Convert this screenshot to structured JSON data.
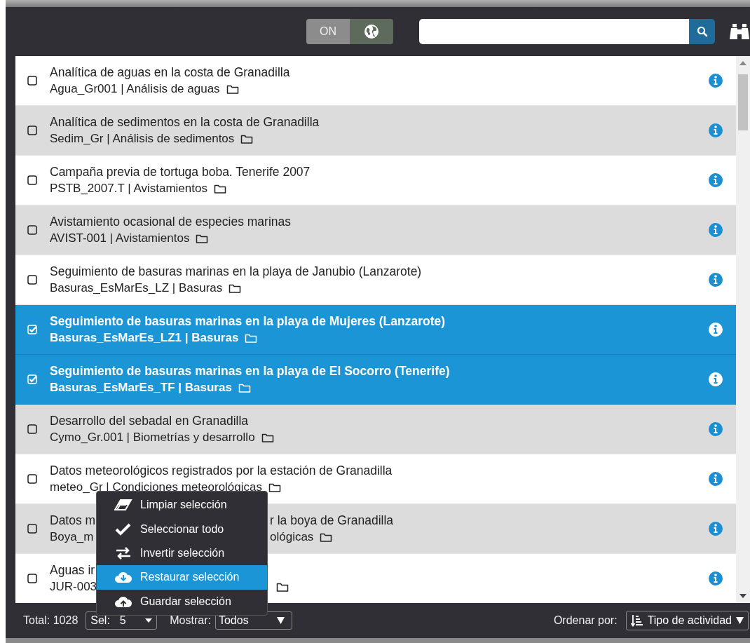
{
  "header": {
    "toggle": {
      "label": "ON",
      "on": true
    }
  },
  "rows": [
    {
      "title": "Analítica de aguas en la costa de Granadilla",
      "subtitle": "Agua_Gr001 | Análisis de aguas",
      "checked": false
    },
    {
      "title": "Analítica de sedimentos en la costa de Granadilla",
      "subtitle": "Sedim_Gr | Análisis de sedimentos",
      "checked": false
    },
    {
      "title": "Campaña previa de tortuga boba. Tenerife 2007",
      "subtitle": "PSTB_2007.T | Avistamientos",
      "checked": false
    },
    {
      "title": "Avistamiento ocasional de especies marinas",
      "subtitle": "AVIST-001 | Avistamientos",
      "checked": false
    },
    {
      "title": "Seguimiento de basuras marinas en la playa de Janubio (Lanzarote)",
      "subtitle": "Basuras_EsMarEs_LZ | Basuras",
      "checked": false
    },
    {
      "title": "Seguimiento de basuras marinas en la playa de Mujeres (Lanzarote)",
      "subtitle": "Basuras_EsMarEs_LZ1 | Basuras",
      "checked": true
    },
    {
      "title": "Seguimiento de basuras marinas en la playa de El Socorro (Tenerife)",
      "subtitle": "Basuras_EsMarEs_TF | Basuras",
      "checked": true
    },
    {
      "title": "Desarrollo del sebadal en Granadilla",
      "subtitle": "Cymo_Gr.001 | Biometrías y desarrollo",
      "checked": false
    },
    {
      "title": "Datos meteorológicos registrados por la estación de Granadilla",
      "subtitle": "meteo_Gr | Condiciones meteorológicas",
      "checked": false
    },
    {
      "title": "Datos m",
      "title_tail": "r la boya de Granadilla",
      "subtitle": "Boya_m",
      "subtitle_tail": "ológicas",
      "checked": false
    },
    {
      "title": "Aguas ir",
      "title_tail": "",
      "subtitle": "JUR-003",
      "subtitle_tail": "",
      "checked": false
    }
  ],
  "menu": [
    {
      "label": "Limpiar selección",
      "selected": false
    },
    {
      "label": "Seleccionar todo",
      "selected": false
    },
    {
      "label": "Invertir selección",
      "selected": false
    },
    {
      "label": "Restaurar selección",
      "selected": true
    },
    {
      "label": "Guardar selección",
      "selected": false
    }
  ],
  "footer": {
    "total": "Total: 1028",
    "sel_label": "Sel:",
    "sel_value": "5",
    "show_label": "Mostrar:",
    "show_value": "Todos",
    "sort_label": "Ordenar por:",
    "sort_value": "Tipo de actividad"
  }
}
